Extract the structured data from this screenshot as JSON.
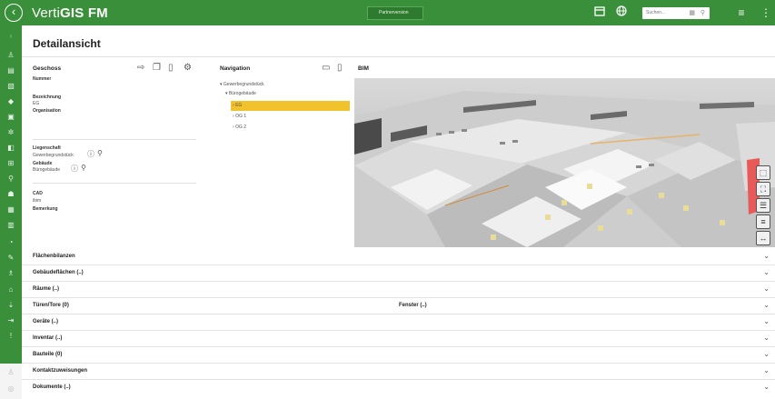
{
  "header": {
    "logo_prefix": "Verti",
    "logo_bold": "GIS FM",
    "partner_button": "Partnerversion",
    "search_placeholder": "Suchen..."
  },
  "page_title": "Detailansicht",
  "geschoss": {
    "title": "Geschoss",
    "fields": {
      "nummer_label": "Nummer",
      "bezeichnung_label": "Bezeichnung",
      "bezeichnung_value": "EG",
      "organisation_label": "Organisation",
      "liegenschaft_label": "Liegenschaft",
      "liegenschaft_value": "Gewerbegrundstück",
      "gebaeude_label": "Gebäude",
      "gebaeude_value": "Bürogebäude",
      "cad_label": "CAD",
      "cad_value": "ibim",
      "bemerkung_label": "Bemerkung"
    }
  },
  "navigation": {
    "title": "Navigation",
    "tree": [
      "Gewerbegrundstück",
      "Bürogebäude",
      "EG",
      "OG 1",
      "OG 2"
    ]
  },
  "bim": {
    "title": "BIM"
  },
  "accordion": [
    "Flächenbilanzen",
    "Gebäudeflächen (..)",
    "Räume (..)",
    "Türen/Tore (0)",
    "Geräte (..)",
    "Inventar (..)",
    "Bauteile (0)",
    "Kontaktzuweisungen",
    "Dokumente (..)"
  ],
  "accordion_extra": {
    "fenster": "Fenster (..)"
  },
  "icons": {
    "back": "back-arrow-icon",
    "calendar": "calendar-icon",
    "globe": "globe-icon",
    "filter": "filter-icon",
    "menu": "kebab-menu-icon"
  },
  "colors": {
    "brand_green": "#3a8f3a",
    "selection_yellow": "#f2c22d"
  }
}
